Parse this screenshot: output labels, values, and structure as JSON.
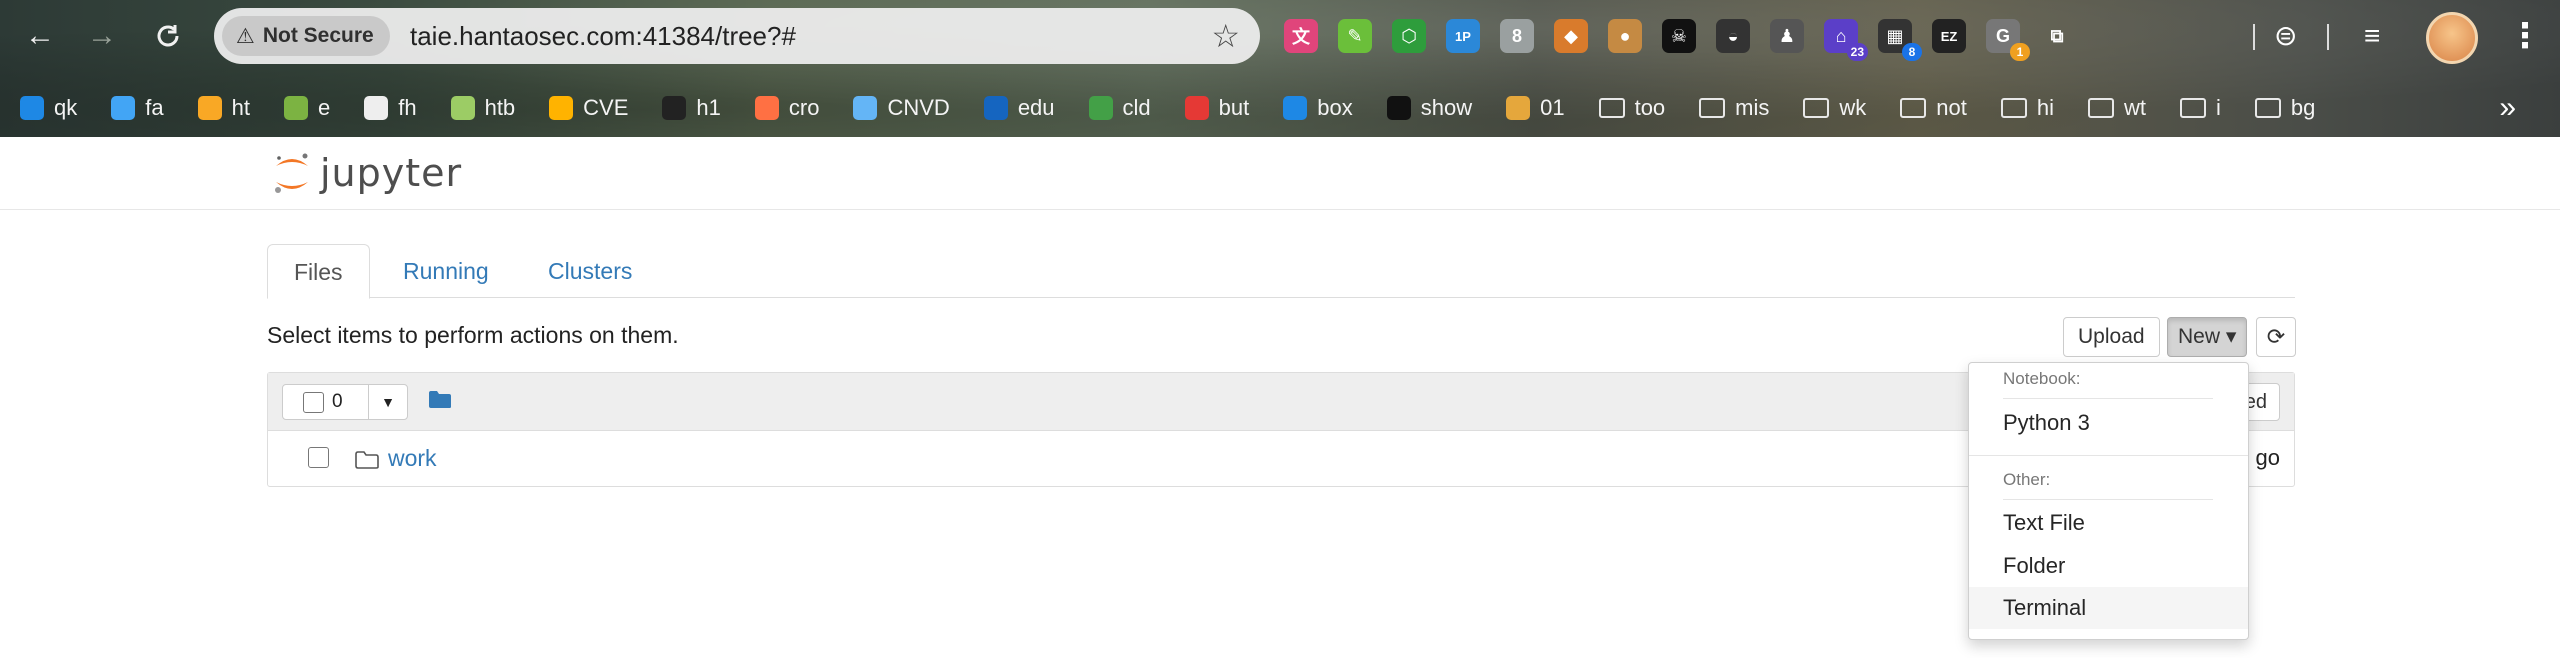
{
  "browser": {
    "nav": {
      "back_icon": "←",
      "forward_icon": "→",
      "reload_icon": "C"
    },
    "security_label": "Not Secure",
    "url": "taie.hantaosec.com:41384/tree?#",
    "extensions": [
      {
        "name": "translate-extension-icon",
        "color": "#e0457b",
        "glyph": "文"
      },
      {
        "name": "leaf-extension-icon",
        "color": "#6bbf3a",
        "glyph": "✎"
      },
      {
        "name": "hex-extension-icon",
        "color": "#2e9d3c",
        "glyph": "⬡"
      },
      {
        "name": "1p-extension-icon",
        "color": "#2b88d8",
        "glyph": "1P"
      },
      {
        "name": "bottle-extension-icon",
        "color": "#9aa0a0",
        "glyph": "8"
      },
      {
        "name": "puzzle-color-extension-icon",
        "color": "#d97b2c",
        "glyph": "◆"
      },
      {
        "name": "cookie-extension-icon",
        "color": "#c58a43",
        "glyph": "●"
      },
      {
        "name": "hacker-extension-icon",
        "color": "#111111",
        "glyph": "☠"
      },
      {
        "name": "hat-extension-icon",
        "color": "#333333",
        "glyph": "◒"
      },
      {
        "name": "figure-extension-icon",
        "color": "#555555",
        "glyph": "♟"
      },
      {
        "name": "graduation-extension-icon",
        "color": "#5b3fc8",
        "glyph": "⌂",
        "badge": "23",
        "badge_color": "#5b3fc8"
      },
      {
        "name": "grid-extension-icon",
        "color": "#333333",
        "glyph": "▦",
        "badge": "8",
        "badge_color": "#1a73e8"
      },
      {
        "name": "ez-extension-icon",
        "color": "#222222",
        "glyph": "EZ"
      },
      {
        "name": "g-extension-icon",
        "color": "#777777",
        "glyph": "G",
        "badge": "1",
        "badge_color": "#f0a020"
      },
      {
        "name": "puzzle-extension-icon",
        "color": "transparent",
        "glyph": "⧉"
      }
    ],
    "bookmarks": [
      {
        "label": "qk",
        "color": "#1e88e5"
      },
      {
        "label": "fa",
        "color": "#42a5f5"
      },
      {
        "label": "ht",
        "color": "#f9a825"
      },
      {
        "label": "e",
        "color": "#7cb342"
      },
      {
        "label": "fh",
        "color": "#eeeeee"
      },
      {
        "label": "htb",
        "color": "#9ccc65"
      },
      {
        "label": "CVE",
        "color": "#ffb300"
      },
      {
        "label": "h1",
        "color": "#222222"
      },
      {
        "label": "cro",
        "color": "#ff7043"
      },
      {
        "label": "CNVD",
        "color": "#64b5f6"
      },
      {
        "label": "edu",
        "color": "#1565c0"
      },
      {
        "label": "cld",
        "color": "#43a047"
      },
      {
        "label": "but",
        "color": "#e53935"
      },
      {
        "label": "box",
        "color": "#1e88e5"
      },
      {
        "label": "show",
        "color": "#111111"
      },
      {
        "label": "01",
        "color": "#e5a73c"
      }
    ],
    "bookmark_folders": [
      "too",
      "mis",
      "wk",
      "not",
      "hi",
      "wt",
      "i",
      "bg"
    ],
    "more_bookmarks": "»"
  },
  "jupyter": {
    "logo_text": "jupyter",
    "tabs": [
      "Files",
      "Running",
      "Clusters"
    ],
    "select_hint": "Select items to perform actions on them.",
    "buttons": {
      "upload": "Upload",
      "new": "New ▾",
      "refresh_icon": "⟳"
    },
    "selected_count": "0",
    "list": {
      "items": [
        {
          "name": "work",
          "modified_fragment": "go"
        }
      ],
      "header_button_fragment": "ed"
    },
    "new_menu": {
      "notebook_header": "Notebook:",
      "notebook_items": [
        "Python 3"
      ],
      "other_header": "Other:",
      "other_items": [
        "Text File",
        "Folder",
        "Terminal"
      ]
    }
  }
}
